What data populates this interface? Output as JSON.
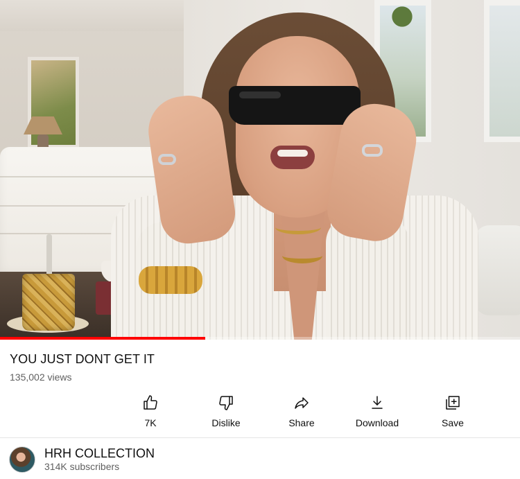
{
  "video": {
    "progress_fraction": 0.395
  },
  "meta": {
    "title": "YOU JUST DONT GET IT",
    "views": "135,002 views"
  },
  "actions": {
    "like": {
      "label": "7K",
      "icon": "thumbs-up-icon"
    },
    "dislike": {
      "label": "Dislike",
      "icon": "thumbs-down-icon"
    },
    "share": {
      "label": "Share",
      "icon": "share-arrow-icon"
    },
    "download": {
      "label": "Download",
      "icon": "download-arrow-icon"
    },
    "save": {
      "label": "Save",
      "icon": "save-to-playlist-icon"
    }
  },
  "channel": {
    "name": "HRH COLLECTION",
    "subscribers": "314K subscribers"
  },
  "colors": {
    "progress": "#ff0000",
    "text_primary": "#0f0f0f",
    "text_secondary": "#606060"
  }
}
